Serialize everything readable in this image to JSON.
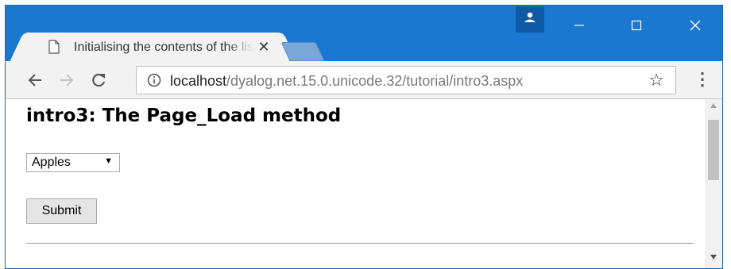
{
  "browser": {
    "tab": {
      "title": "Initialising the contents of the list",
      "close_glyph": "✕"
    },
    "toolbar": {
      "back_glyph": "←",
      "forward_glyph": "→",
      "reload_glyph": "C",
      "url_host": "localhost",
      "url_path": "/dyalog.net.15.0.unicode.32/tutorial/intro3.aspx",
      "star_icon": "☆",
      "menu_icon": "⋮"
    },
    "window_controls": {
      "minimize": "–",
      "maximize": "☐",
      "close": "✕"
    },
    "icons": {
      "page": "page-icon",
      "info": "info-icon",
      "profile": "profile-icon"
    },
    "colors": {
      "titlebar": "#1b78d0",
      "tab_bg": "#f2f2f2"
    }
  },
  "page": {
    "heading": "intro3: The Page_Load method",
    "dropdown": {
      "selected": "Apples",
      "arrow": "▼"
    },
    "submit_label": "Submit"
  }
}
